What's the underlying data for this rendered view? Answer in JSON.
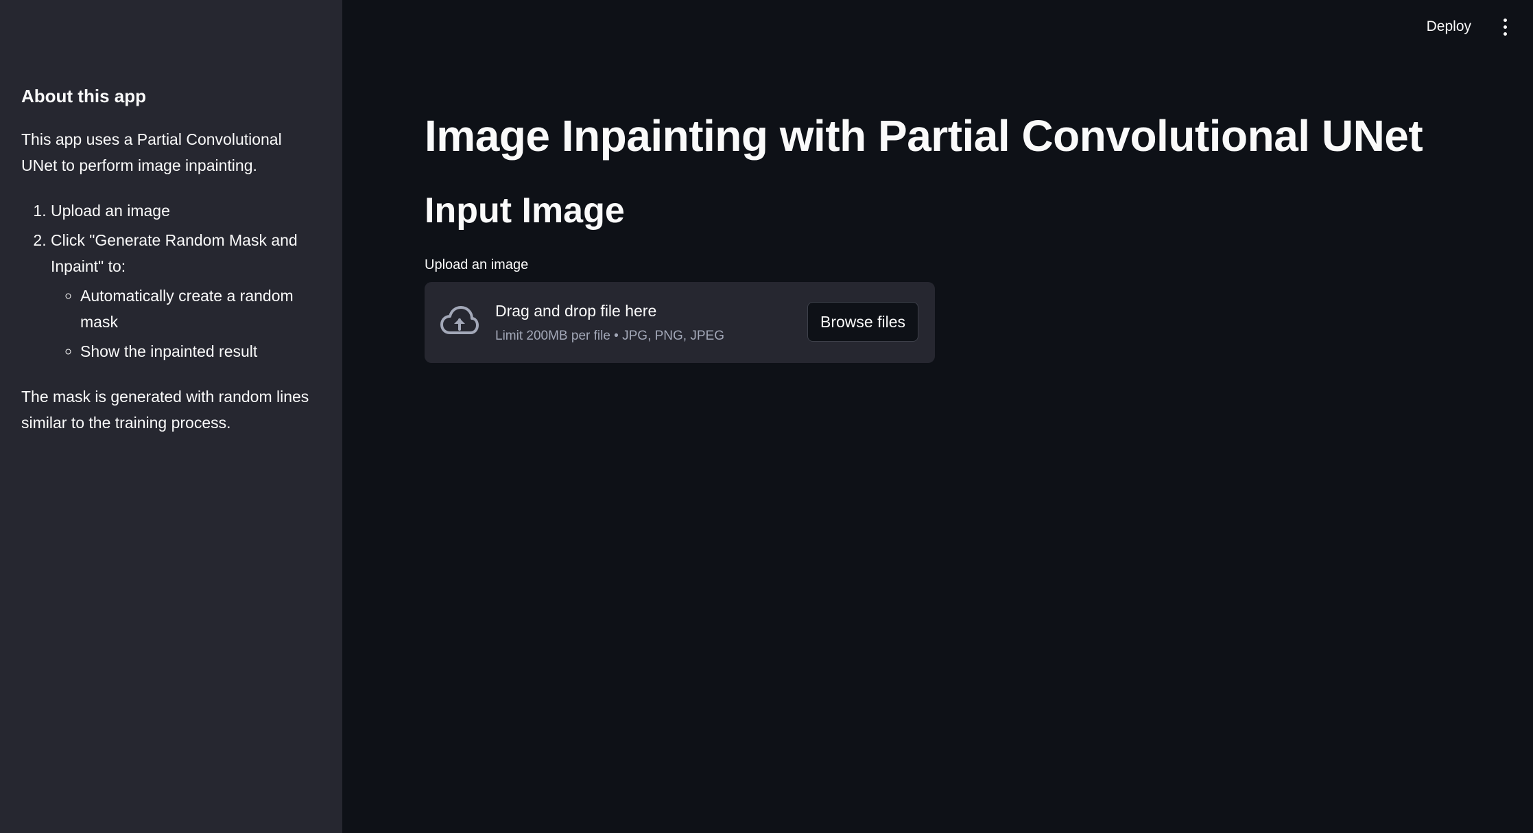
{
  "header": {
    "deploy_label": "Deploy",
    "menu_icon": "vertical-ellipsis-icon"
  },
  "sidebar": {
    "heading": "About this app",
    "intro": "This app uses a Partial Convolutional UNet to perform image inpainting.",
    "steps": [
      {
        "text": "Upload an image"
      },
      {
        "text": "Click \"Generate Random Mask and Inpaint\" to:",
        "substeps": [
          "Automatically create a random mask",
          "Show the inpainted result"
        ]
      }
    ],
    "footer": "The mask is generated with random lines similar to the training process."
  },
  "main": {
    "title": "Image Inpainting with Partial Convolutional UNet",
    "section_title": "Input Image",
    "uploader": {
      "label": "Upload an image",
      "drop_text": "Drag and drop file here",
      "limit_text": "Limit 200MB per file • JPG, PNG, JPEG",
      "browse_label": "Browse files",
      "icon": "cloud-upload-icon"
    }
  },
  "colors": {
    "background": "#0e1117",
    "sidebar": "#262730",
    "text": "#fafafa",
    "muted_text": "#a3a8b8"
  }
}
